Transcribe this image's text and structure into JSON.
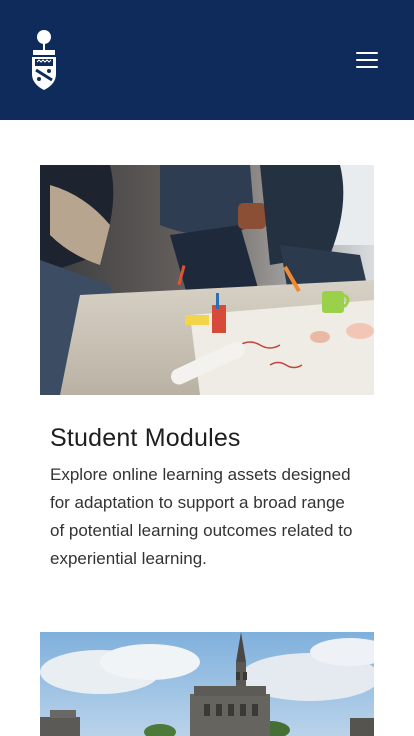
{
  "header": {
    "background_color": "#0f2b5b",
    "logo_icon": "university-crest-icon",
    "menu_icon": "hamburger-menu-icon"
  },
  "cards": [
    {
      "image_icon": "students-working-photo",
      "title": "Student Modules",
      "description": "Explore online learning assets designed for adaptation to support a broad range of potential learning outcomes related to experiential learning."
    },
    {
      "image_icon": "campus-tower-photo"
    }
  ]
}
